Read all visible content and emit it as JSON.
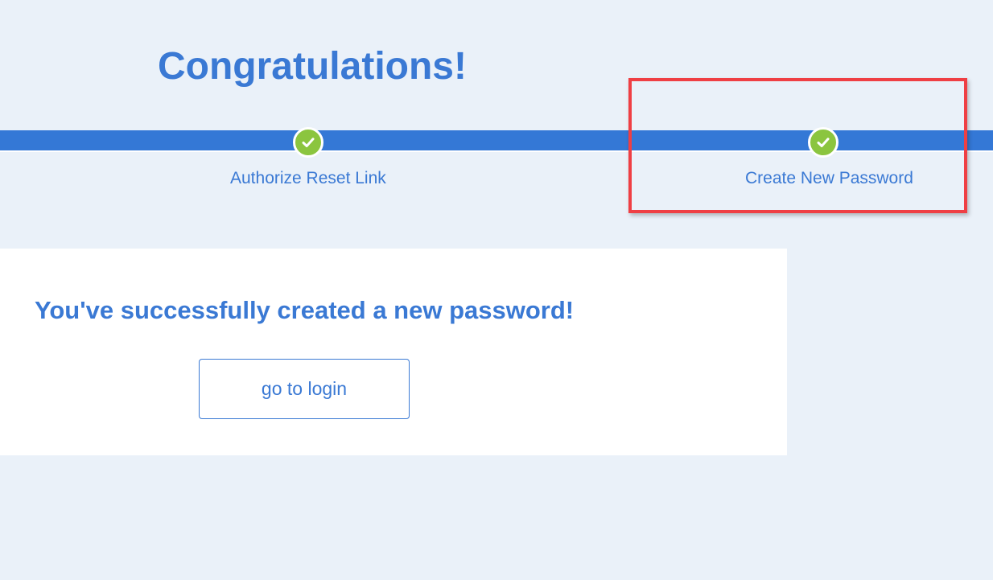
{
  "page": {
    "title": "Congratulations!",
    "background_color": "#eaf1f9",
    "accent_color": "#3a79d4"
  },
  "progress": {
    "bar_color": "#3478d6",
    "check_color": "#8bc53f",
    "steps": [
      {
        "label": "Authorize Reset Link",
        "status": "complete",
        "icon": "check-icon"
      },
      {
        "label": "Create New Password",
        "status": "complete",
        "icon": "check-icon"
      }
    ]
  },
  "highlight": {
    "color": "#ef3f44"
  },
  "card": {
    "message": "You've successfully created a new password!",
    "button_label": "go to login"
  }
}
